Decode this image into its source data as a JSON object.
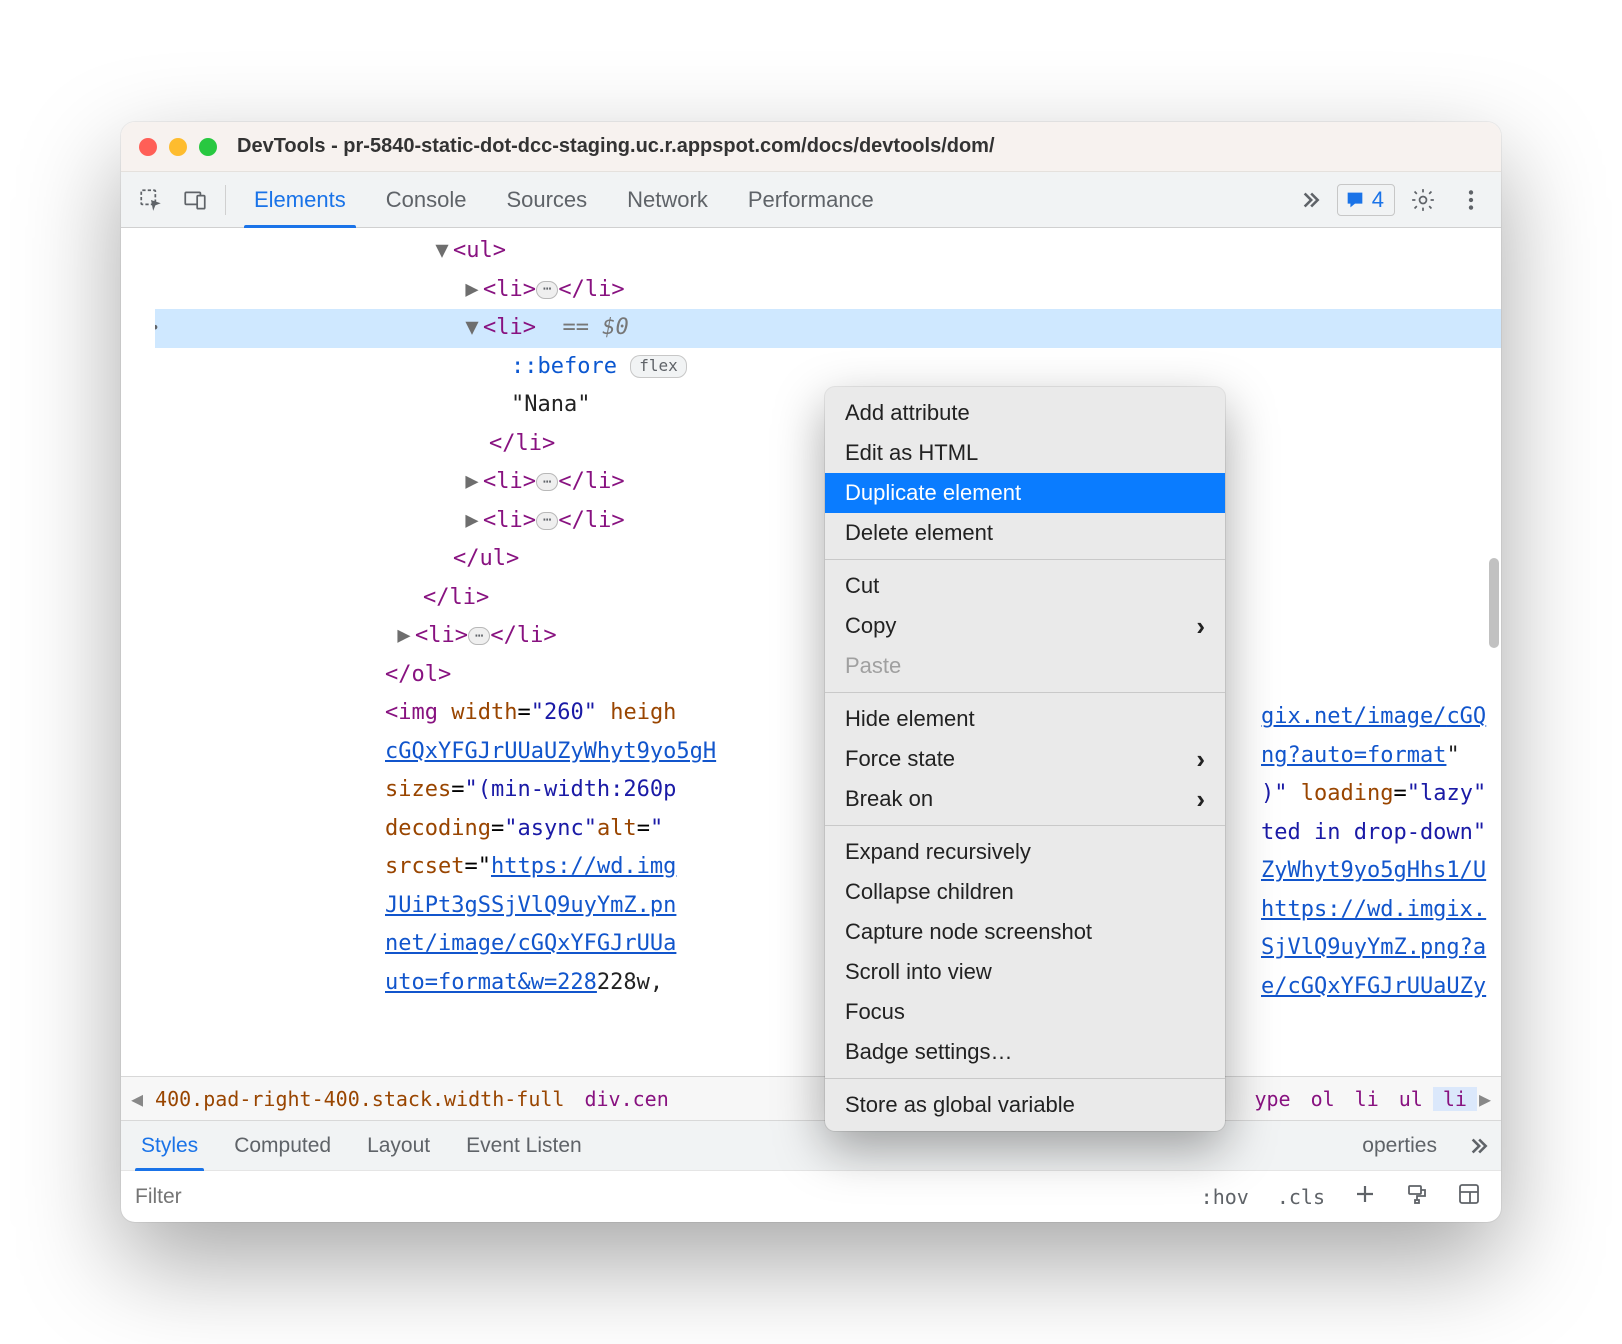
{
  "window": {
    "title": "DevTools - pr-5840-static-dot-dcc-staging.uc.r.appspot.com/docs/devtools/dom/"
  },
  "toolbar": {
    "tabs": [
      "Elements",
      "Console",
      "Sources",
      "Network",
      "Performance"
    ],
    "issue_count": "4"
  },
  "tree": {
    "ul_open": "<ul>",
    "li_coll": "<li>",
    "li_close_inline": "</li>",
    "li_open": "<li>",
    "eq0": "== $0",
    "before": "::before",
    "before_badge": "flex",
    "text_nana": "\"Nana\"",
    "li_close": "</li>",
    "ul_close": "</ul>",
    "outer_li_close": "</li>",
    "ol_close": "</ol>",
    "img_line": {
      "pre": "<img",
      "w_name": "width",
      "w_val": "\"260\"",
      "h_name": "heigh",
      "link1_pre": "gix.net/image/",
      "link1_mid": "cGQxYFGJrUUaUZyWhyt9yo5gH",
      "link1_suf": "ng?auto=format",
      "sizes_name": "sizes",
      "sizes_val": "\"(min-width:260p",
      "sizes_close": ")\"",
      "loading_name": "loading",
      "loading_val": "\"lazy\"",
      "decoding_name": "decoding",
      "decoding_val": "\"async\"",
      "alt_name": "alt",
      "alt_val": "\"",
      "alt_tail": "ted in drop-down\"",
      "srcset_name": "srcset",
      "srcset_l1a": "https://wd.img",
      "srcset_l1b": "ZyWhyt9yo5gHhs1/U",
      "srcset_l2a": "JUiPt3gSSjVlQ9uyYmZ.pn",
      "srcset_l2b": "https://wd.imgix.",
      "srcset_l3a": "net/image/cGQxYFGJrUUa",
      "srcset_l3b": "SjVlQ9uyYmZ.png?a",
      "srcset_l4a": "uto=format&w=228",
      "srcset_228": "228w,",
      "srcset_l4b": "e/cGQxYFGJrUUaUZy"
    }
  },
  "breadcrumbs": {
    "first": "400.pad-right-400.stack.width-full",
    "second": "div.cen",
    "third": "ype",
    "items": [
      "ol",
      "li",
      "ul",
      "li"
    ]
  },
  "styles_tabs": [
    "Styles",
    "Computed",
    "Layout",
    "Event Listen",
    "operties"
  ],
  "filter": {
    "placeholder": "Filter",
    "hov": ":hov",
    "cls": ".cls"
  },
  "context_menu": {
    "items": [
      {
        "label": "Add attribute"
      },
      {
        "label": "Edit as HTML"
      },
      {
        "label": "Duplicate element",
        "selected": true
      },
      {
        "label": "Delete element"
      },
      {
        "sep": true
      },
      {
        "label": "Cut"
      },
      {
        "label": "Copy",
        "submenu": true
      },
      {
        "label": "Paste",
        "disabled": true
      },
      {
        "sep": true
      },
      {
        "label": "Hide element"
      },
      {
        "label": "Force state",
        "submenu": true
      },
      {
        "label": "Break on",
        "submenu": true
      },
      {
        "sep": true
      },
      {
        "label": "Expand recursively"
      },
      {
        "label": "Collapse children"
      },
      {
        "label": "Capture node screenshot"
      },
      {
        "label": "Scroll into view"
      },
      {
        "label": "Focus"
      },
      {
        "label": "Badge settings…"
      },
      {
        "sep": true
      },
      {
        "label": "Store as global variable"
      }
    ]
  }
}
